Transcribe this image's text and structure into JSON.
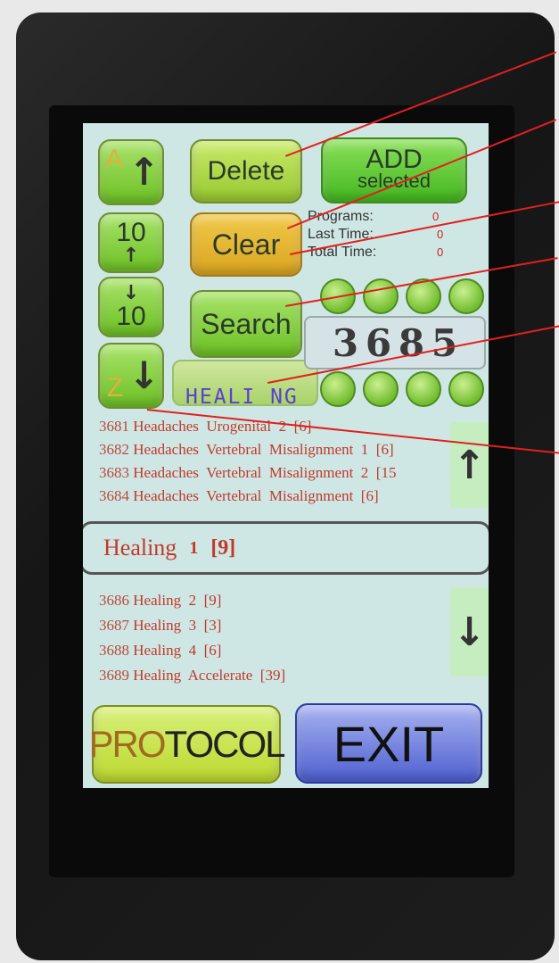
{
  "top_left_button": {
    "letter": "A",
    "arrow": "↑"
  },
  "up_ten_button": {
    "value": "10",
    "arrow": "↑"
  },
  "down_ten_button": {
    "value": "10",
    "arrow": "↓"
  },
  "bottom_left_button": {
    "letter": "Z",
    "arrow": "↓"
  },
  "buttons": {
    "delete": "Delete",
    "add_line1": "ADD",
    "add_line2": "selected",
    "clear": "Clear",
    "search": "Search",
    "protocol_prefix": "PRO",
    "protocol_suffix": "TOCOL",
    "exit": "EXIT"
  },
  "stats": {
    "programs_label": "Programs:",
    "programs_value": "0",
    "last_time_label": "Last Time:",
    "last_time_value": "0",
    "total_time_label": "Total Time:",
    "total_time_value": "0"
  },
  "search_text": "HEALI NG",
  "number_display": [
    "3",
    "6",
    "8",
    "5"
  ],
  "list_before": [
    {
      "num": "3681",
      "text": "Headaches  Urogenital  2  [6]"
    },
    {
      "num": "3682",
      "text": "Headaches  Vertebral  Misalignment  1  [6]"
    },
    {
      "num": "3683",
      "text": "Headaches  Vertebral  Misalignment  2  [15"
    },
    {
      "num": "3684",
      "text": "Headaches  Vertebral  Misalignment  [6]"
    }
  ],
  "selected_item": {
    "name": "Healing",
    "num": "1",
    "bracket": "[9]"
  },
  "list_after": [
    {
      "num": "3686",
      "text": "Healing  2  [9]"
    },
    {
      "num": "3687",
      "text": "Healing  3  [3]"
    },
    {
      "num": "3688",
      "text": "Healing  4  [6]"
    },
    {
      "num": "3689",
      "text": "Healing  Accelerate  [39]"
    }
  ],
  "scroll_arrows": {
    "up": "↑",
    "down": "↓"
  },
  "colors": {
    "screen_bg": "#cfe7e4",
    "list_text": "#c0392b",
    "search_text": "#5a3fd0",
    "callout": "#e02020"
  }
}
